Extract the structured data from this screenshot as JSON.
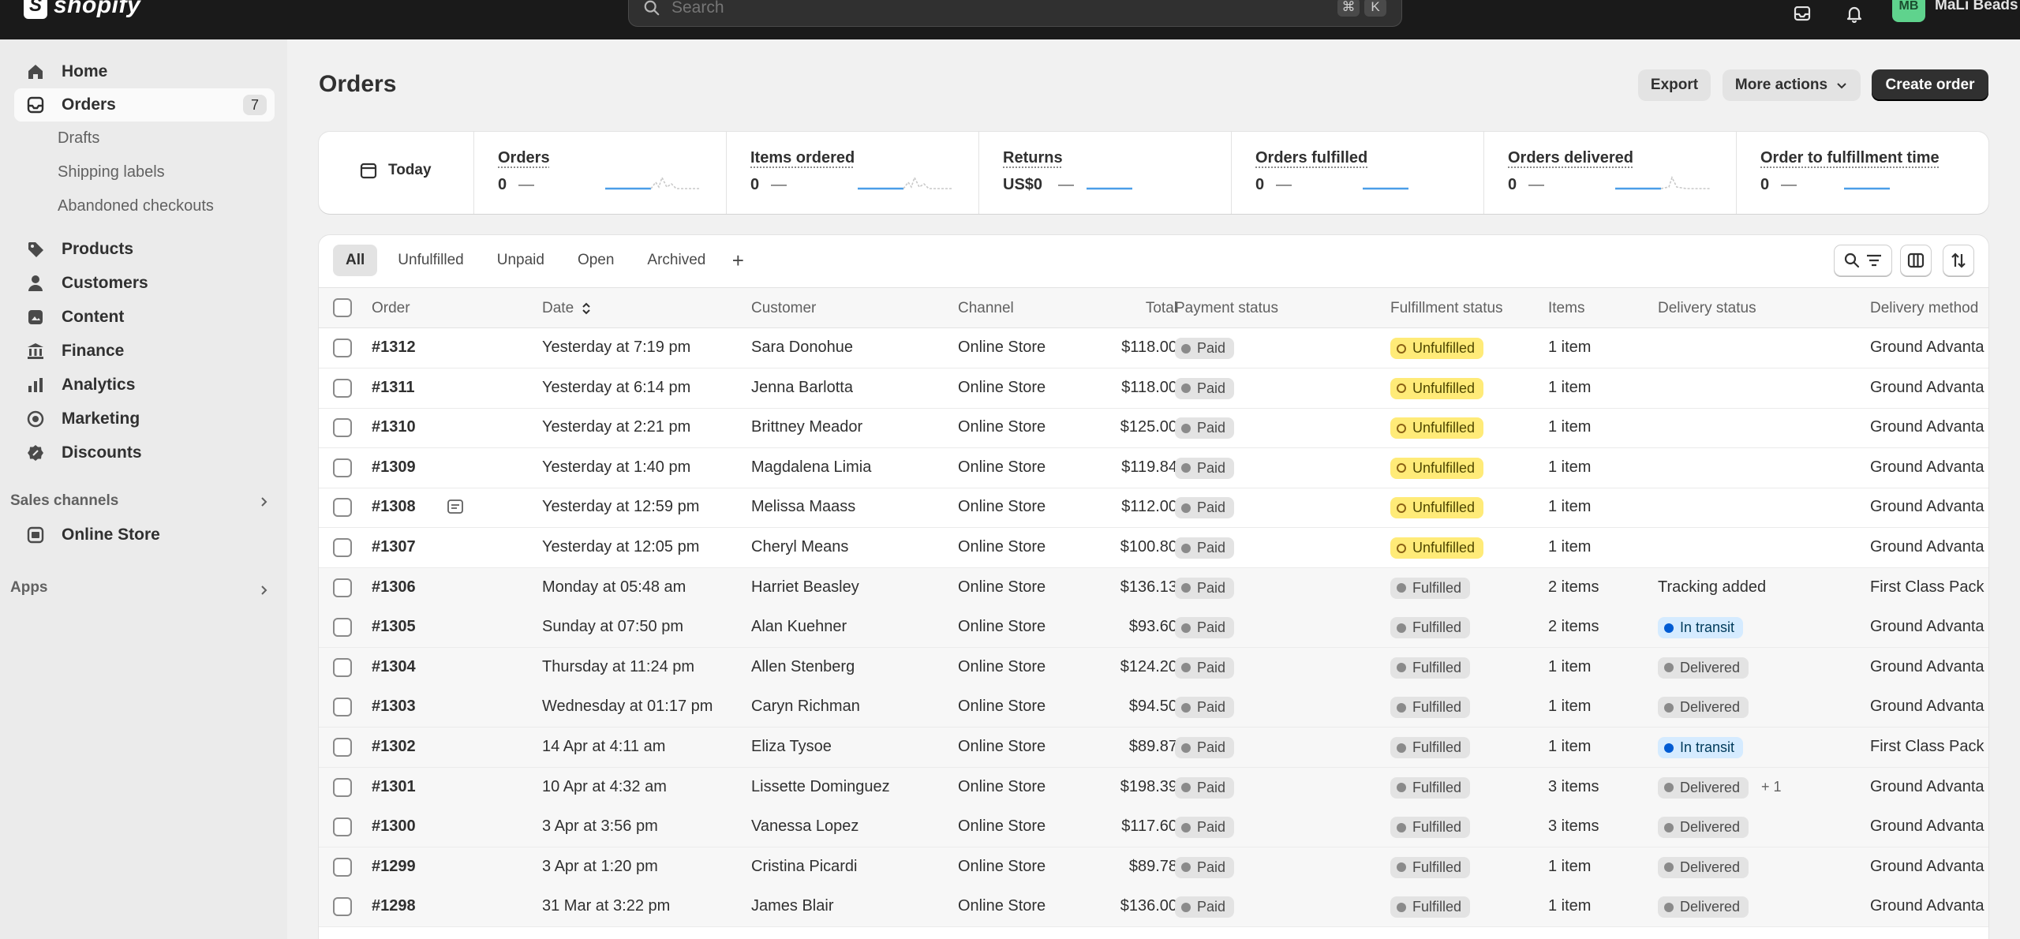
{
  "topbar": {
    "logo_text": "shopify",
    "logo_letter": "S",
    "search_placeholder": "Search",
    "kbd_cmd": "⌘",
    "kbd_k": "K",
    "store_initials": "MB",
    "store_name": "MaLi Beads"
  },
  "sidebar": {
    "items": [
      {
        "label": "Home",
        "icon": "home-icon"
      },
      {
        "label": "Orders",
        "icon": "inbox-icon",
        "count": "7",
        "active": true
      },
      {
        "label": "Products",
        "icon": "tag-icon"
      },
      {
        "label": "Customers",
        "icon": "person-icon"
      },
      {
        "label": "Content",
        "icon": "content-icon"
      },
      {
        "label": "Finance",
        "icon": "bank-icon"
      },
      {
        "label": "Analytics",
        "icon": "chart-icon"
      },
      {
        "label": "Marketing",
        "icon": "target-icon"
      },
      {
        "label": "Discounts",
        "icon": "discount-icon"
      }
    ],
    "orders_sub": [
      "Drafts",
      "Shipping labels",
      "Abandoned checkouts"
    ],
    "sales_channels_label": "Sales channels",
    "online_store_label": "Online Store",
    "apps_label": "Apps"
  },
  "header": {
    "title": "Orders",
    "export": "Export",
    "more_actions": "More actions",
    "create_order": "Create order"
  },
  "metrics": {
    "today": "Today",
    "items": [
      {
        "label": "Orders",
        "value": "0",
        "dash": "—"
      },
      {
        "label": "Items ordered",
        "value": "0",
        "dash": "—"
      },
      {
        "label": "Returns",
        "value": "US$0",
        "dash": "—"
      },
      {
        "label": "Orders fulfilled",
        "value": "0",
        "dash": "—"
      },
      {
        "label": "Orders delivered",
        "value": "0",
        "dash": "—"
      },
      {
        "label": "Order to fulfillment time",
        "value": "0",
        "dash": "—"
      }
    ]
  },
  "tabs": [
    "All",
    "Unfulfilled",
    "Unpaid",
    "Open",
    "Archived"
  ],
  "table": {
    "headers": {
      "order": "Order",
      "date": "Date",
      "customer": "Customer",
      "channel": "Channel",
      "total": "Total",
      "payment": "Payment status",
      "fulfillment": "Fulfillment status",
      "items": "Items",
      "delivery_status": "Delivery status",
      "delivery_method": "Delivery method"
    },
    "rows": [
      {
        "order": "#1312",
        "date": "Yesterday at 7:19 pm",
        "customer": "Sara Donohue",
        "channel": "Online Store",
        "total": "$118.00",
        "payment": "Paid",
        "fulfillment": "Unfulfilled",
        "items": "1 item",
        "delivery_status": "",
        "delivery_method": "Ground Advanta"
      },
      {
        "order": "#1311",
        "date": "Yesterday at 6:14 pm",
        "customer": "Jenna Barlotta",
        "channel": "Online Store",
        "total": "$118.00",
        "payment": "Paid",
        "fulfillment": "Unfulfilled",
        "items": "1 item",
        "delivery_status": "",
        "delivery_method": "Ground Advanta"
      },
      {
        "order": "#1310",
        "date": "Yesterday at 2:21 pm",
        "customer": "Brittney Meador",
        "channel": "Online Store",
        "total": "$125.00",
        "payment": "Paid",
        "fulfillment": "Unfulfilled",
        "items": "1 item",
        "delivery_status": "",
        "delivery_method": "Ground Advanta"
      },
      {
        "order": "#1309",
        "date": "Yesterday at 1:40 pm",
        "customer": "Magdalena Limia",
        "channel": "Online Store",
        "total": "$119.84",
        "payment": "Paid",
        "fulfillment": "Unfulfilled",
        "items": "1 item",
        "delivery_status": "",
        "delivery_method": "Ground Advanta"
      },
      {
        "order": "#1308",
        "date": "Yesterday at 12:59 pm",
        "customer": "Melissa Maass",
        "channel": "Online Store",
        "total": "$112.00",
        "payment": "Paid",
        "fulfillment": "Unfulfilled",
        "items": "1 item",
        "delivery_status": "",
        "delivery_method": "Ground Advanta",
        "note": true
      },
      {
        "order": "#1307",
        "date": "Yesterday at 12:05 pm",
        "customer": "Cheryl Means",
        "channel": "Online Store",
        "total": "$100.80",
        "payment": "Paid",
        "fulfillment": "Unfulfilled",
        "items": "1 item",
        "delivery_status": "",
        "delivery_method": "Ground Advanta"
      },
      {
        "order": "#1306",
        "date": "Monday at 05:48 am",
        "customer": "Harriet Beasley",
        "channel": "Online Store",
        "total": "$136.13",
        "payment": "Paid",
        "fulfillment": "Fulfilled",
        "items": "2 items",
        "delivery_status": "Tracking added",
        "delivery_kind": "text",
        "delivery_method": "First Class Pack"
      },
      {
        "order": "#1305",
        "date": "Sunday at 07:50 pm",
        "customer": "Alan Kuehner",
        "channel": "Online Store",
        "total": "$93.60",
        "payment": "Paid",
        "fulfillment": "Fulfilled",
        "items": "2 items",
        "delivery_status": "In transit",
        "delivery_kind": "transit",
        "delivery_method": "Ground Advanta"
      },
      {
        "order": "#1304",
        "date": "Thursday at 11:24 pm",
        "customer": "Allen Stenberg",
        "channel": "Online Store",
        "total": "$124.20",
        "payment": "Paid",
        "fulfillment": "Fulfilled",
        "items": "1 item",
        "delivery_status": "Delivered",
        "delivery_kind": "delivered",
        "delivery_method": "Ground Advanta"
      },
      {
        "order": "#1303",
        "date": "Wednesday at 01:17 pm",
        "customer": "Caryn Richman",
        "channel": "Online Store",
        "total": "$94.50",
        "payment": "Paid",
        "fulfillment": "Fulfilled",
        "items": "1 item",
        "delivery_status": "Delivered",
        "delivery_kind": "delivered",
        "delivery_method": "Ground Advanta"
      },
      {
        "order": "#1302",
        "date": "14 Apr at 4:11 am",
        "customer": "Eliza Tysoe",
        "channel": "Online Store",
        "total": "$89.87",
        "payment": "Paid",
        "fulfillment": "Fulfilled",
        "items": "1 item",
        "delivery_status": "In transit",
        "delivery_kind": "transit",
        "delivery_method": "First Class Pack"
      },
      {
        "order": "#1301",
        "date": "10 Apr at 4:32 am",
        "customer": "Lissette Dominguez",
        "channel": "Online Store",
        "total": "$198.39",
        "payment": "Paid",
        "fulfillment": "Fulfilled",
        "items": "3 items",
        "delivery_status": "Delivered",
        "delivery_kind": "delivered",
        "delivery_extra": "+ 1",
        "delivery_method": "Ground Advanta"
      },
      {
        "order": "#1300",
        "date": "3 Apr at 3:56 pm",
        "customer": "Vanessa Lopez",
        "channel": "Online Store",
        "total": "$117.60",
        "payment": "Paid",
        "fulfillment": "Fulfilled",
        "items": "3 items",
        "delivery_status": "Delivered",
        "delivery_kind": "delivered",
        "delivery_method": "Ground Advanta"
      },
      {
        "order": "#1299",
        "date": "3 Apr at 1:20 pm",
        "customer": "Cristina Picardi",
        "channel": "Online Store",
        "total": "$89.78",
        "payment": "Paid",
        "fulfillment": "Fulfilled",
        "items": "1 item",
        "delivery_status": "Delivered",
        "delivery_kind": "delivered",
        "delivery_method": "Ground Advanta"
      },
      {
        "order": "#1298",
        "date": "31 Mar at 3:22 pm",
        "customer": "James Blair",
        "channel": "Online Store",
        "total": "$136.00",
        "payment": "Paid",
        "fulfillment": "Fulfilled",
        "items": "1 item",
        "delivery_status": "Delivered",
        "delivery_kind": "delivered",
        "delivery_method": "Ground Advanta"
      }
    ]
  }
}
